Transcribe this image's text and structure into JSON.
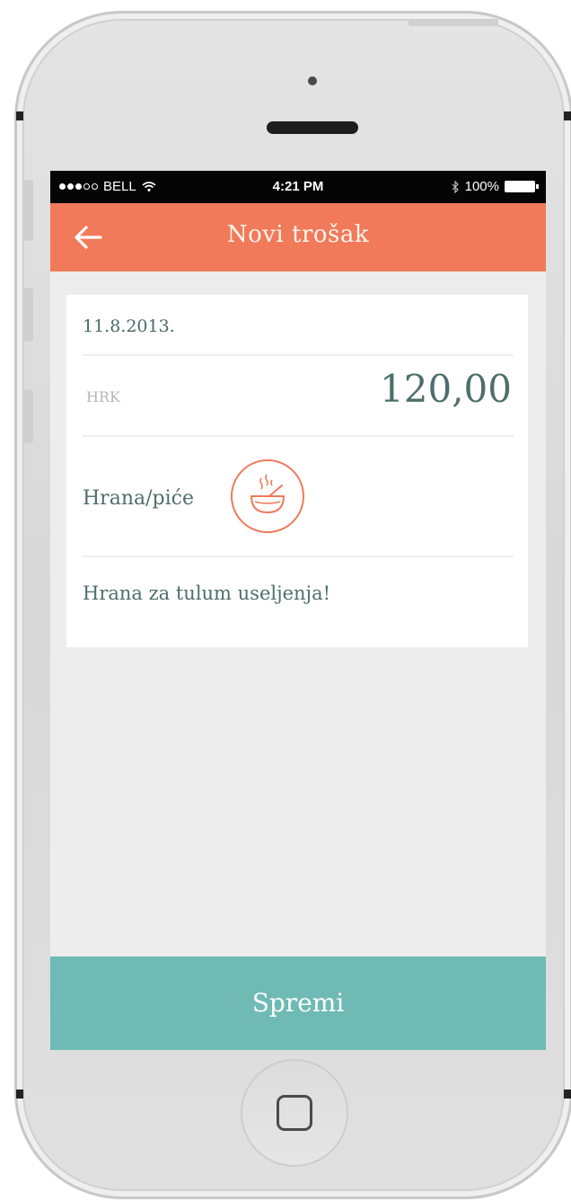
{
  "status_bar": {
    "carrier": "BELL",
    "time": "4:21 PM",
    "battery": "100%"
  },
  "header": {
    "title": "Novi trošak"
  },
  "form": {
    "date": "11.8.2013.",
    "currency": "HRK",
    "amount": "120,00",
    "category": "Hrana/piće",
    "category_icon": "food-bowl-icon",
    "note": "Hrana za tulum useljenja!"
  },
  "actions": {
    "save_label": "Spremi"
  },
  "colors": {
    "header_bg": "#f07a5a",
    "save_bg": "#6fbab5",
    "text_primary": "#4e6e6c",
    "icon_accent": "#f07a5a"
  }
}
